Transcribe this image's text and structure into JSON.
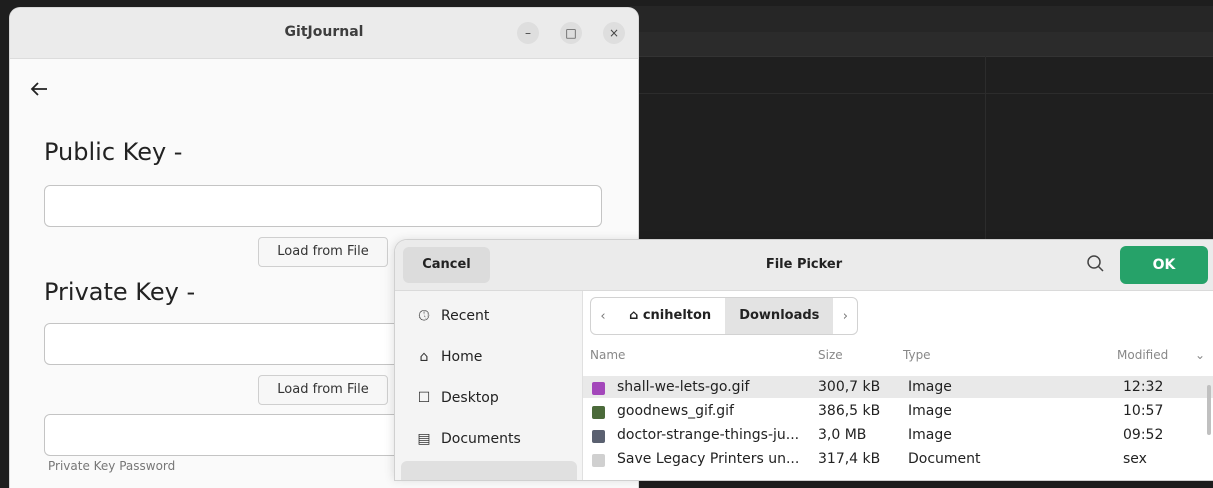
{
  "gitjournal": {
    "title": "GitJournal",
    "window_controls": {
      "minimize": "–",
      "maximize": "□",
      "close": "×"
    },
    "back_icon": "left-arrow-icon",
    "public_key_heading": "Public Key -",
    "private_key_heading": "Private Key -",
    "load_from_file_label": "Load from File",
    "private_key_password_label": "Private Key Password"
  },
  "file_picker": {
    "cancel_label": "Cancel",
    "title": "File Picker",
    "ok_label": "OK",
    "accent_color": "#26a269",
    "sidebar": [
      {
        "icon": "clock-icon",
        "label": "Recent"
      },
      {
        "icon": "home-icon",
        "label": "Home"
      },
      {
        "icon": "desktop-icon",
        "label": "Desktop"
      },
      {
        "icon": "document-icon",
        "label": "Documents"
      }
    ],
    "breadcrumb": {
      "home": "cnihelton",
      "current": "Downloads"
    },
    "columns": {
      "name": "Name",
      "size": "Size",
      "type": "Type",
      "modified": "Modified"
    },
    "files": [
      {
        "name": "shall-we-lets-go.gif",
        "size": "300,7 kB",
        "type": "Image",
        "modified": "12:32",
        "icon_color": "#a347ba"
      },
      {
        "name": "goodnews_gif.gif",
        "size": "386,5 kB",
        "type": "Image",
        "modified": "10:57",
        "icon_color": "#4b6a3a"
      },
      {
        "name": "doctor-strange-things-ju...",
        "size": "3,0 MB",
        "type": "Image",
        "modified": "09:52",
        "icon_color": "#5a6070"
      },
      {
        "name": "Save Legacy Printers un...",
        "size": "317,4 kB",
        "type": "Document",
        "modified": "sex",
        "icon_color": "#d0d0d0"
      }
    ]
  }
}
